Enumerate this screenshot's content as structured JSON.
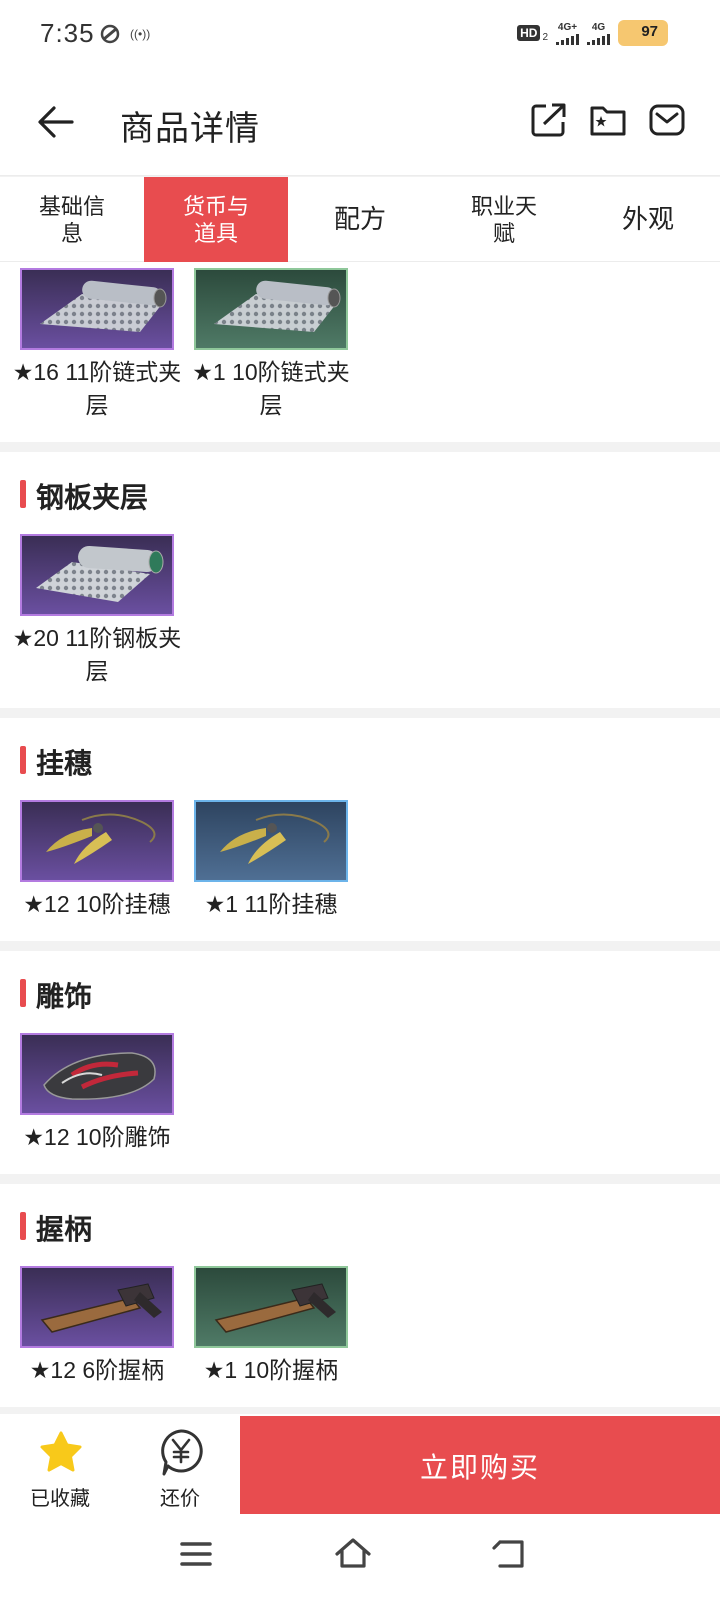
{
  "status_bar": {
    "time": "7:35",
    "radio_glyph": "((•))",
    "hd_label": "HD",
    "hd_sub": "2",
    "net1": "4G+",
    "net2": "4G",
    "battery": "97"
  },
  "header": {
    "title": "商品详情",
    "icons": [
      "share-icon",
      "folder-star-icon",
      "message-icon"
    ]
  },
  "tabs": [
    {
      "label": "基础信息",
      "active": false
    },
    {
      "label": "货币与道具",
      "active": true
    },
    {
      "label": "配方",
      "active": false
    },
    {
      "label": "职业天赋",
      "active": false
    },
    {
      "label": "外观",
      "active": false
    }
  ],
  "sections": [
    {
      "title": "",
      "items": [
        {
          "label": "★16 11阶链式夹层",
          "frame": "purple",
          "art": "chain-roll-icon"
        },
        {
          "label": "★1 10阶链式夹层",
          "frame": "green",
          "art": "chain-roll-icon"
        }
      ]
    },
    {
      "title": "钢板夹层",
      "items": [
        {
          "label": "★20 11阶钢板夹层",
          "frame": "purple",
          "art": "plate-roll-icon"
        }
      ]
    },
    {
      "title": "挂穗",
      "items": [
        {
          "label": "★12 10阶挂穗",
          "frame": "purple",
          "art": "tassel-icon"
        },
        {
          "label": "★1 11阶挂穗",
          "frame": "blue",
          "art": "tassel-icon"
        }
      ]
    },
    {
      "title": "雕饰",
      "items": [
        {
          "label": "★12 10阶雕饰",
          "frame": "purple",
          "art": "carving-icon"
        }
      ]
    },
    {
      "title": "握柄",
      "items": [
        {
          "label": "★12 6阶握柄",
          "frame": "purple",
          "art": "grip-icon"
        },
        {
          "label": "★1 10阶握柄",
          "frame": "green",
          "art": "grip-icon"
        }
      ]
    }
  ],
  "bottom_bar": {
    "favorite_label": "已收藏",
    "bargain_label": "还价",
    "buy_label": "立即购买"
  },
  "colors": {
    "accent": "#e84c4f",
    "frame_purple": "#b37be0",
    "frame_green": "#8fc79a",
    "frame_blue": "#6cb4ea",
    "star_yellow": "#f8c91a"
  }
}
